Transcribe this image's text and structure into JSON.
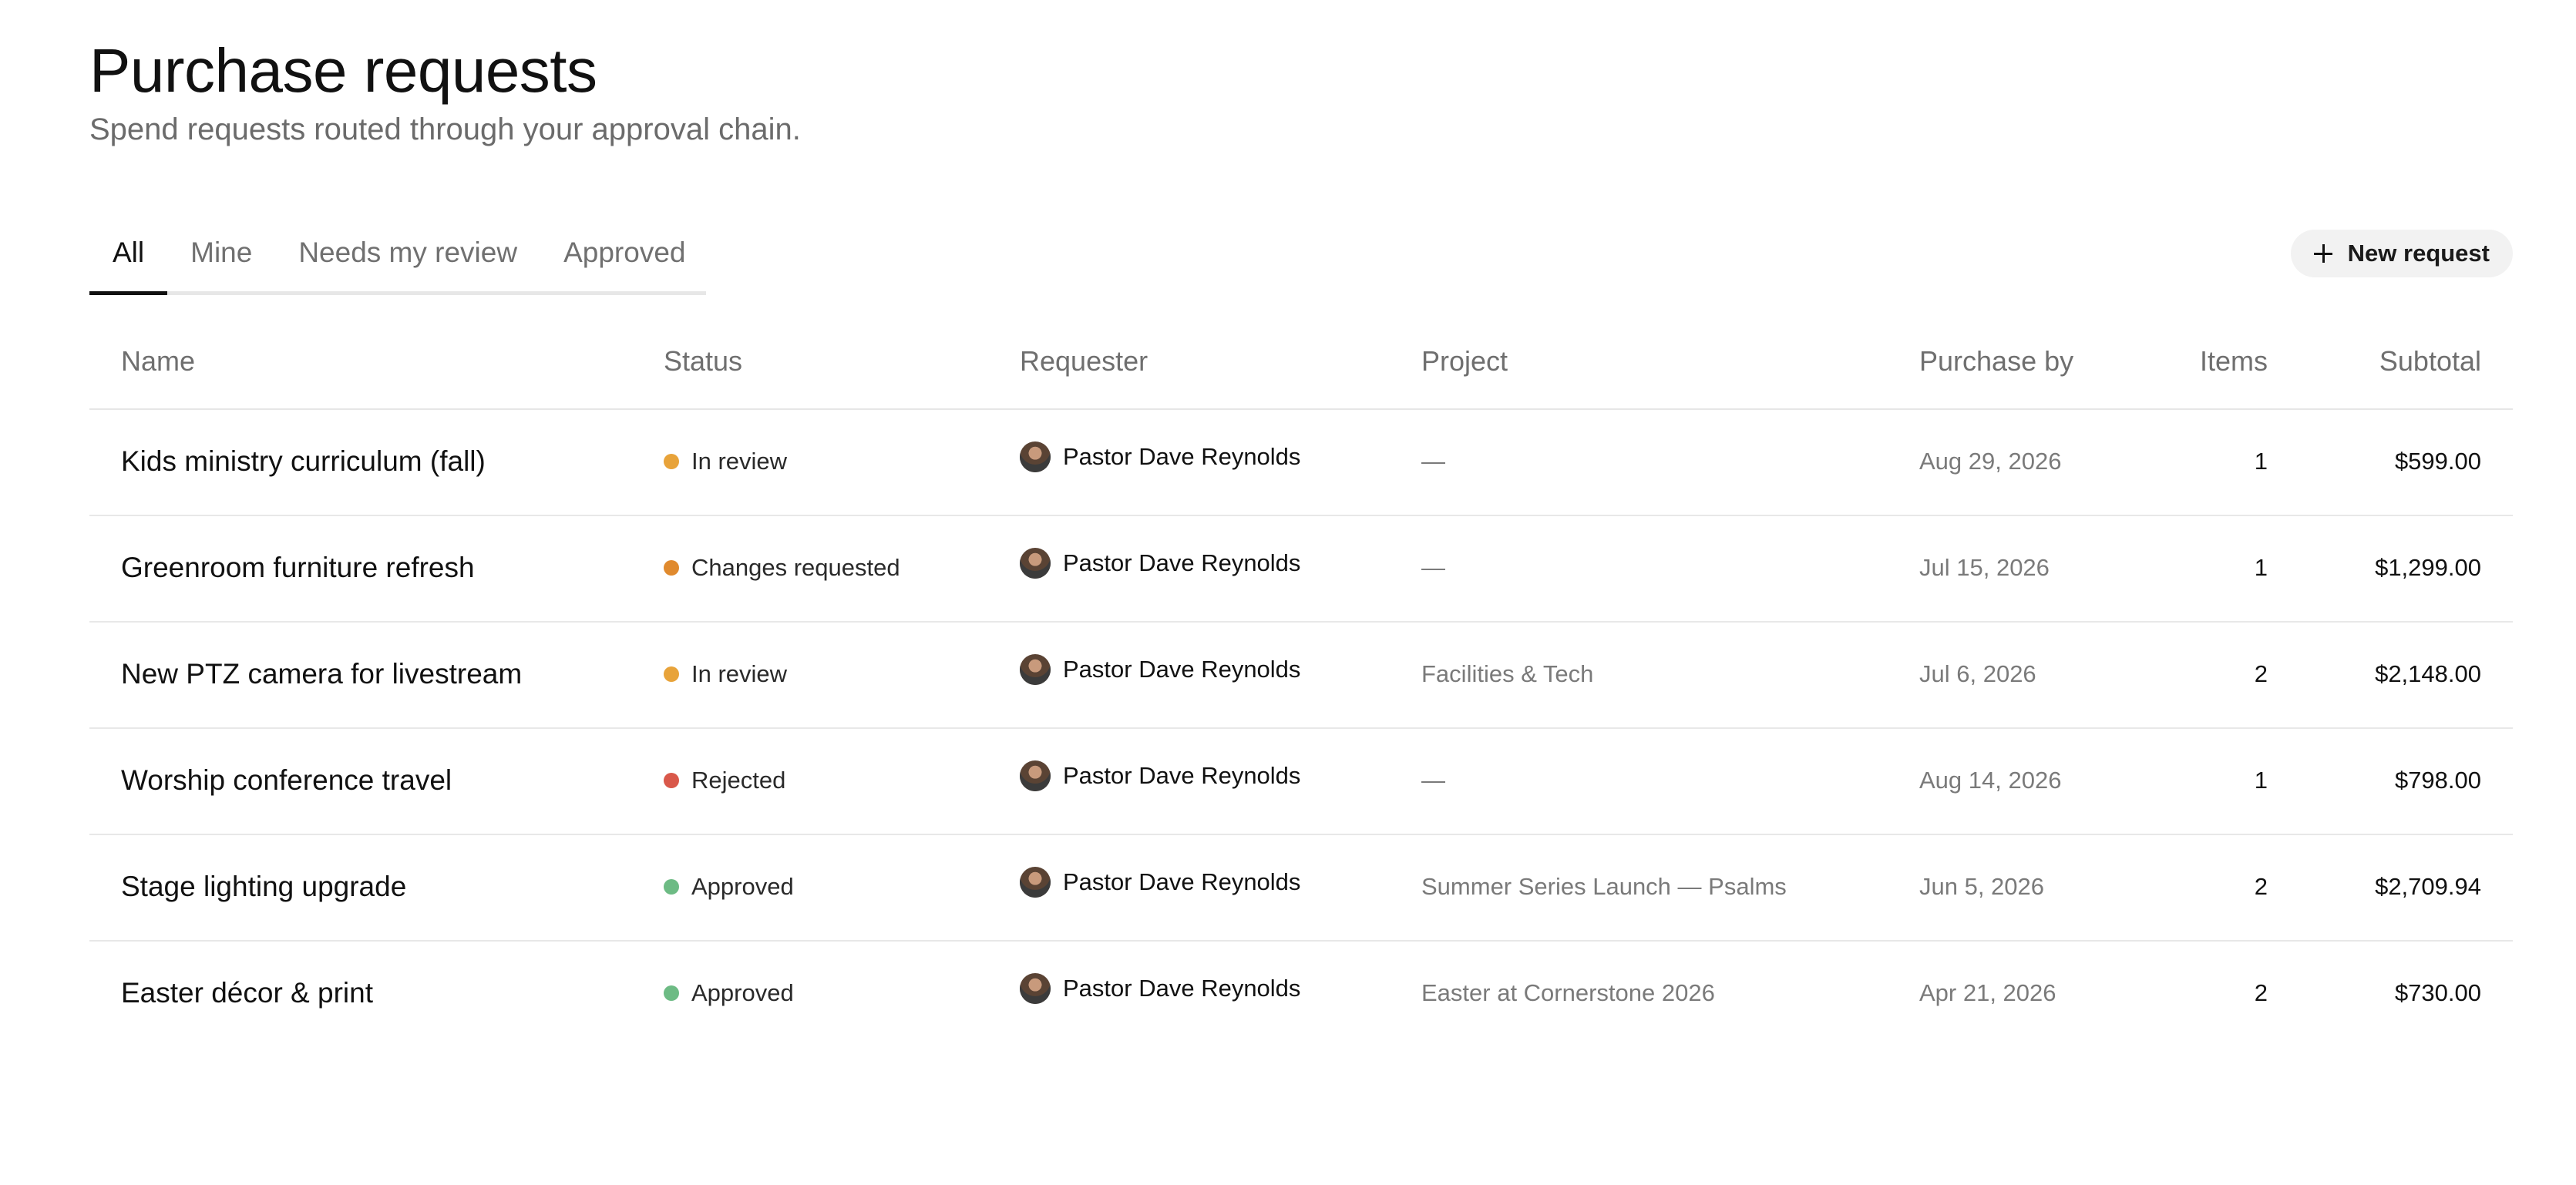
{
  "header": {
    "title": "Purchase requests",
    "subtitle": "Spend requests routed through your approval chain."
  },
  "tabs": [
    {
      "label": "All",
      "active": true
    },
    {
      "label": "Mine",
      "active": false
    },
    {
      "label": "Needs my review",
      "active": false
    },
    {
      "label": "Approved",
      "active": false
    }
  ],
  "actions": {
    "new_request_label": "New request",
    "new_request_icon": "plus-icon"
  },
  "table": {
    "columns": {
      "name": "Name",
      "status": "Status",
      "requester": "Requester",
      "project": "Project",
      "purchase_by": "Purchase by",
      "items": "Items",
      "subtotal": "Subtotal"
    },
    "rows": [
      {
        "name": "Kids ministry curriculum (fall)",
        "status": "In review",
        "status_color": "#E8A33A",
        "requester": "Pastor Dave Reynolds",
        "project": "—",
        "purchase_by": "Aug 29, 2026",
        "items": "1",
        "subtotal": "$599.00"
      },
      {
        "name": "Greenroom furniture refresh",
        "status": "Changes requested",
        "status_color": "#E08A2E",
        "requester": "Pastor Dave Reynolds",
        "project": "—",
        "purchase_by": "Jul 15, 2026",
        "items": "1",
        "subtotal": "$1,299.00"
      },
      {
        "name": "New PTZ camera for livestream",
        "status": "In review",
        "status_color": "#E8A33A",
        "requester": "Pastor Dave Reynolds",
        "project": "Facilities & Tech",
        "purchase_by": "Jul 6, 2026",
        "items": "2",
        "subtotal": "$2,148.00"
      },
      {
        "name": "Worship conference travel",
        "status": "Rejected",
        "status_color": "#D9584A",
        "requester": "Pastor Dave Reynolds",
        "project": "—",
        "purchase_by": "Aug 14, 2026",
        "items": "1",
        "subtotal": "$798.00"
      },
      {
        "name": "Stage lighting upgrade",
        "status": "Approved",
        "status_color": "#6DBB84",
        "requester": "Pastor Dave Reynolds",
        "project": "Summer Series Launch — Psalms",
        "purchase_by": "Jun 5, 2026",
        "items": "2",
        "subtotal": "$2,709.94"
      },
      {
        "name": "Easter décor & print",
        "status": "Approved",
        "status_color": "#6DBB84",
        "requester": "Pastor Dave Reynolds",
        "project": "Easter at Cornerstone 2026",
        "purchase_by": "Apr 21, 2026",
        "items": "2",
        "subtotal": "$730.00"
      }
    ]
  }
}
